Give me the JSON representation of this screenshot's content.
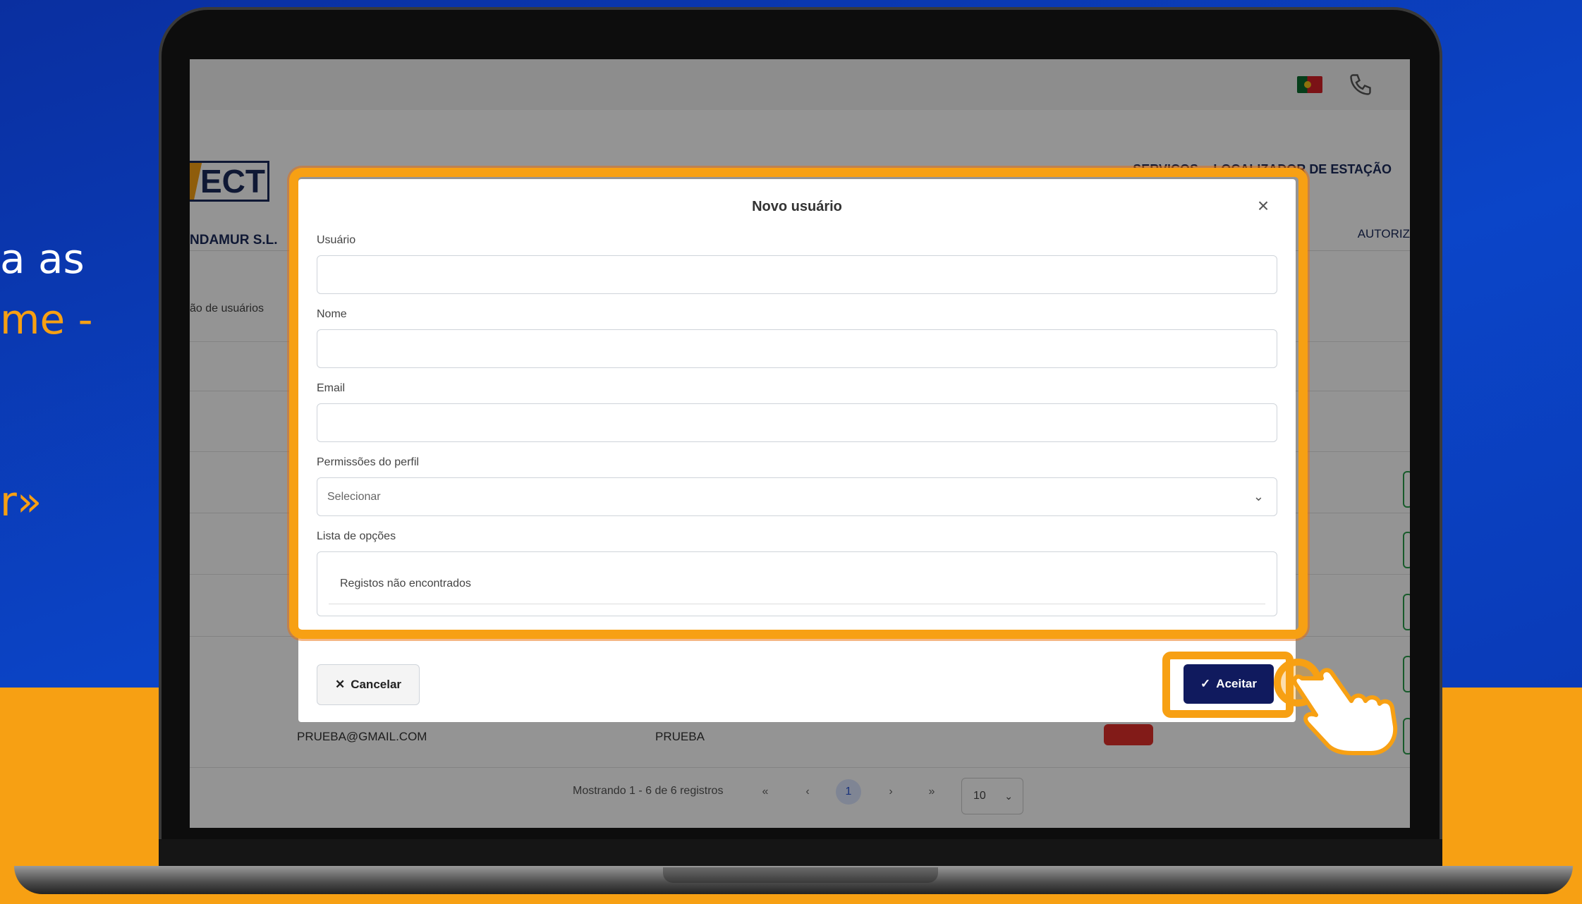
{
  "promo": {
    "line1": "a as",
    "line2": "me -",
    "line3": "r»"
  },
  "topbar": {
    "flag_icon": "portugal-flag-icon",
    "phone_icon": "phone-icon"
  },
  "header": {
    "logo_text": "ECT",
    "company": "NDAMUR S.L.",
    "nav": [
      "SERVIÇOS",
      "LOCALIZADOR DE ESTAÇÃO",
      "AUTORIZ"
    ],
    "sidebar_link": "ão de usuários"
  },
  "table": {
    "last_row": {
      "email": "PRUEBA@GMAIL.COM",
      "name": "PRUEBA"
    }
  },
  "pagination": {
    "summary": "Mostrando 1 - 6 de 6 registros",
    "first": "«",
    "prev": "‹",
    "current": "1",
    "next": "›",
    "last": "»",
    "page_size": "10"
  },
  "modal": {
    "title": "Novo usuário",
    "close_icon": "close-icon",
    "fields": {
      "usuario": {
        "label": "Usuário",
        "value": "",
        "placeholder": ""
      },
      "nome": {
        "label": "Nome",
        "value": "",
        "placeholder": ""
      },
      "email": {
        "label": "Email",
        "value": "",
        "placeholder": ""
      },
      "permissoes": {
        "label": "Permissões do perfil",
        "selected": "Selecionar"
      },
      "lista": {
        "label": "Lista de opções",
        "empty_text": "Registos não encontrados"
      }
    },
    "buttons": {
      "cancel": "Cancelar",
      "accept": "Aceitar"
    }
  },
  "colors": {
    "brand_navy": "#101a5e",
    "highlight_orange": "#f7a013",
    "background_blue": "#0b45c8"
  }
}
